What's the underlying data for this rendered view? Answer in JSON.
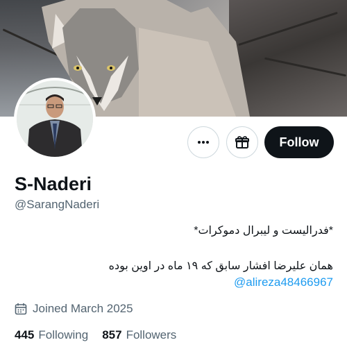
{
  "profile": {
    "display_name": "S-Naderi",
    "handle": "@SarangNaderi",
    "bio_line1": "*فدرالیست و لیبرال دموکرات*",
    "bio_line2": "همان علیرضا افشار سابق که ۱۹ ماه در اوین بوده",
    "bio_mention": "@alireza48466967",
    "joined": "Joined March 2025"
  },
  "stats": {
    "following_count": "445",
    "following_label": "Following",
    "followers_count": "857",
    "followers_label": "Followers"
  },
  "actions": {
    "more_icon": "more-horizontal-icon",
    "gift_icon": "gift-icon",
    "follow_label": "Follow"
  },
  "colors": {
    "accent_link": "#1d9bf0",
    "secondary_text": "#536471",
    "primary_text": "#0f1419",
    "follow_bg": "#0f1419"
  }
}
